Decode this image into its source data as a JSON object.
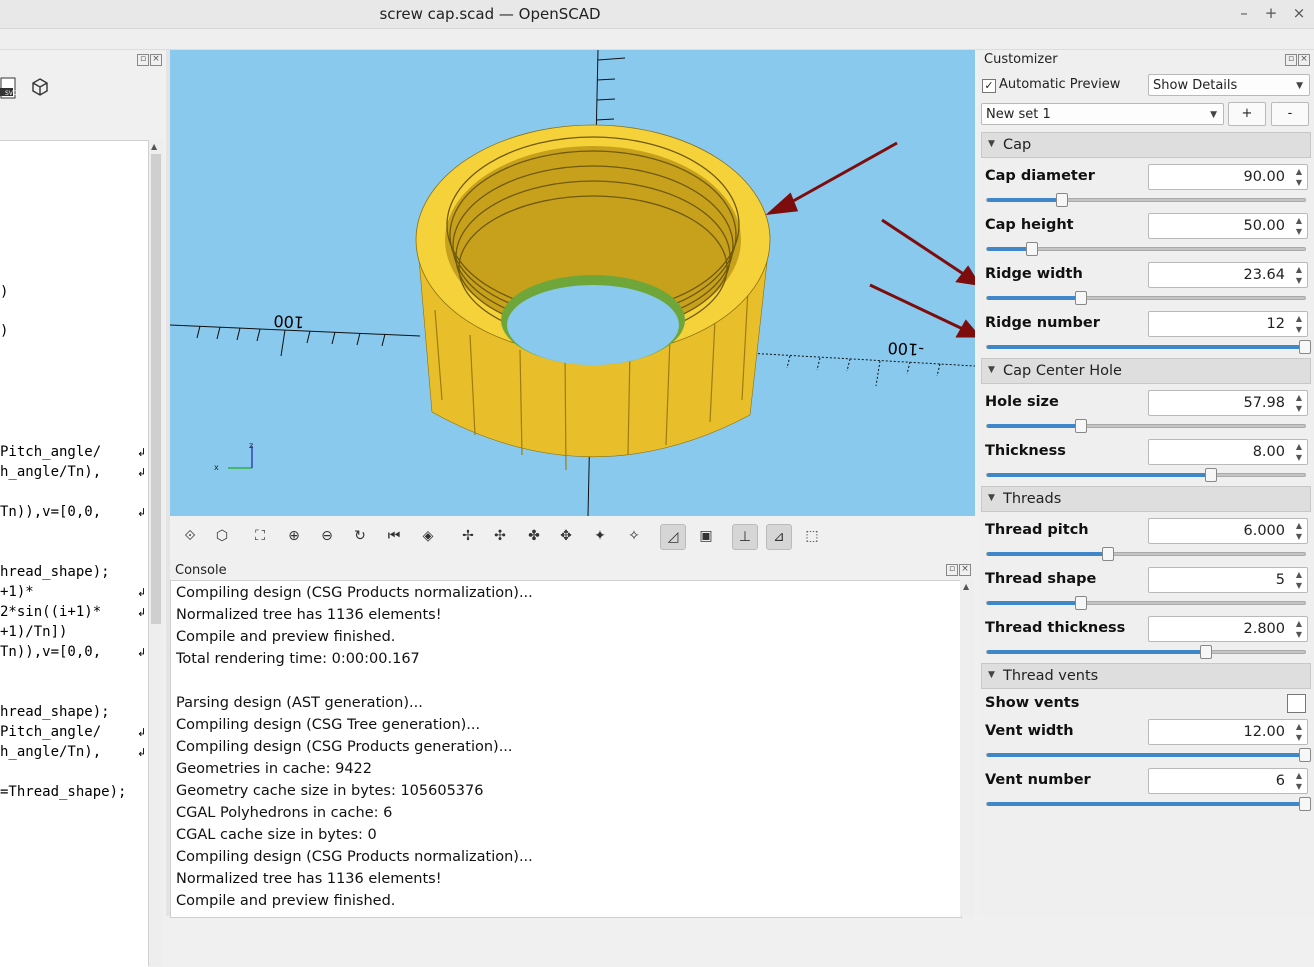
{
  "window": {
    "title": "screw cap.scad — OpenSCAD",
    "minimize": "–",
    "maximize": "+",
    "close": "×"
  },
  "editor": {
    "toolbar": {
      "svg_label": "SVG"
    },
    "lines": [
      {
        "text": ")",
        "wrap": false
      },
      {
        "text": ")",
        "wrap": false
      },
      {
        "text": "Pitch_angle/",
        "wrap": true
      },
      {
        "text": "h_angle/Tn),",
        "wrap": true
      },
      {
        "text": "Tn)),v=[0,0,",
        "wrap": true
      },
      {
        "text": "hread_shape);",
        "wrap": false
      },
      {
        "text": "+1)*",
        "wrap": true
      },
      {
        "text": "2*sin((i+1)*",
        "wrap": true
      },
      {
        "text": "+1)/Tn])",
        "wrap": false
      },
      {
        "text": "Tn)),v=[0,0,",
        "wrap": true
      },
      {
        "text": "hread_shape);",
        "wrap": false
      },
      {
        "text": "Pitch_angle/",
        "wrap": true
      },
      {
        "text": "h_angle/Tn),",
        "wrap": true
      },
      {
        "text": "=Thread_shape);",
        "wrap": false
      }
    ]
  },
  "viewport": {
    "axis_label_left": "100",
    "axis_label_right": "-100",
    "axes_small": {
      "x": "x",
      "z": "z"
    }
  },
  "console": {
    "title": "Console",
    "lines": [
      "Compiling design (CSG Products normalization)...",
      "Normalized tree has 1136 elements!",
      "Compile and preview finished.",
      "Total rendering time: 0:00:00.167",
      "",
      "Parsing design (AST generation)...",
      "Compiling design (CSG Tree generation)...",
      "Compiling design (CSG Products generation)...",
      "Geometries in cache: 9422",
      "Geometry cache size in bytes: 105605376",
      "CGAL Polyhedrons in cache: 6",
      "CGAL cache size in bytes: 0",
      "Compiling design (CSG Products normalization)...",
      "Normalized tree has 1136 elements!",
      "Compile and preview finished."
    ]
  },
  "customizer": {
    "title": "Customizer",
    "auto_preview_label": "Automatic Preview",
    "auto_preview_checked": true,
    "details_select": "Show Details",
    "preset_select": "New set 1",
    "add_label": "+",
    "remove_label": "-",
    "sections": [
      {
        "name": "Cap",
        "params": [
          {
            "label": "Cap diameter",
            "value": "90.00",
            "level": 0.235
          },
          {
            "label": "Cap height",
            "value": "50.00",
            "level": 0.14
          },
          {
            "label": "Ridge width",
            "value": "23.64",
            "level": 0.295
          },
          {
            "label": "Ridge number",
            "value": "12",
            "level": 1.0
          }
        ]
      },
      {
        "name": "Cap Center Hole",
        "params": [
          {
            "label": "Hole size",
            "value": "57.98",
            "level": 0.297
          },
          {
            "label": "Thickness",
            "value": "8.00",
            "level": 0.705
          }
        ]
      },
      {
        "name": "Threads",
        "params": [
          {
            "label": "Thread pitch",
            "value": "6.000",
            "level": 0.38
          },
          {
            "label": "Thread shape",
            "value": "5",
            "level": 0.295
          },
          {
            "label": "Thread thickness",
            "value": "2.800",
            "level": 0.69
          }
        ]
      },
      {
        "name": "Thread vents",
        "show_vents_label": "Show vents",
        "show_vents_checked": false,
        "params": [
          {
            "label": "Vent width",
            "value": "12.00",
            "level": 1.0
          },
          {
            "label": "Vent number",
            "value": "6",
            "level": 1.0
          }
        ]
      }
    ]
  },
  "colors": {
    "viewport_bg": "#89c9ee",
    "model": "#f6d23a",
    "arrow": "#7d0c0c",
    "slider_fill": "#3f87c9"
  }
}
